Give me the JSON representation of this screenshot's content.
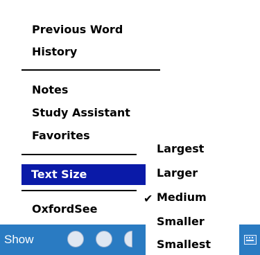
{
  "menu": {
    "items": [
      {
        "label": "Previous Word"
      },
      {
        "label": "History"
      },
      {
        "label": "Notes"
      },
      {
        "label": "Study Assistant"
      },
      {
        "label": "Favorites"
      },
      {
        "label": "Text Size"
      },
      {
        "label": "OxfordSee"
      }
    ]
  },
  "submenu": {
    "items": [
      {
        "label": "Largest"
      },
      {
        "label": "Larger"
      },
      {
        "label": "Medium",
        "checked": true
      },
      {
        "label": "Smaller"
      },
      {
        "label": "Smallest"
      }
    ],
    "check_mark": "✔"
  },
  "taskbar": {
    "show_label": "Show"
  }
}
